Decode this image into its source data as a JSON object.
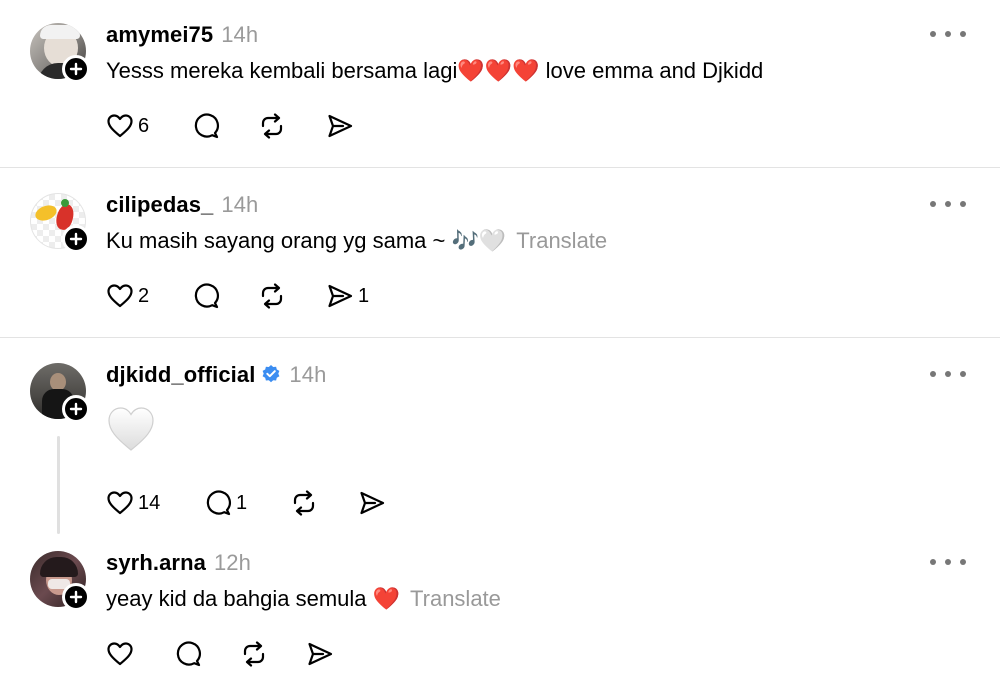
{
  "posts": [
    {
      "username": "amymei75",
      "time": "14h",
      "verified": false,
      "text": "Yesss mereka kembali bersama lagi❤️❤️❤️ love emma and Djkidd",
      "translate": "",
      "likes": "6",
      "replies": "",
      "reposts": "",
      "shares": ""
    },
    {
      "username": "cilipedas_",
      "time": "14h",
      "verified": false,
      "text": "Ku masih sayang orang yg sama ~ 🎶🤍",
      "translate": "Translate",
      "likes": "2",
      "replies": "",
      "reposts": "",
      "shares": "1"
    },
    {
      "username": "djkidd_official",
      "time": "14h",
      "verified": true,
      "text": "",
      "translate": "",
      "likes": "14",
      "replies": "1",
      "reposts": "",
      "shares": ""
    },
    {
      "username": "syrh.arna",
      "time": "12h",
      "verified": false,
      "text": "yeay kid da bahgia semula ❤️",
      "translate": "Translate",
      "likes": "",
      "replies": "",
      "reposts": "",
      "shares": ""
    }
  ],
  "icons": {
    "like": "heart-icon",
    "reply": "comment-icon",
    "repost": "repost-icon",
    "share": "send-icon",
    "more": "more-icon",
    "follow": "plus-icon",
    "verified": "verified-badge-icon"
  },
  "colors": {
    "verified": "#3b8df1",
    "muted": "#9a9a9a",
    "follow": "#000000"
  }
}
